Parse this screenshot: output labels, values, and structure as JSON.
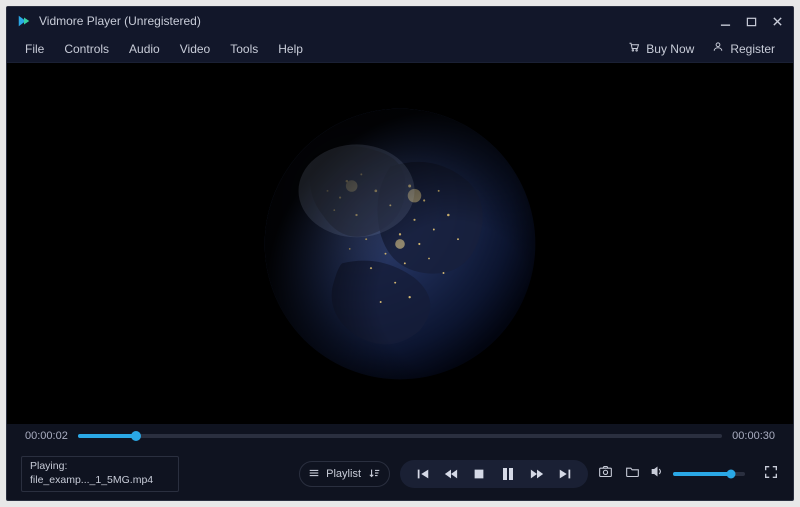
{
  "window": {
    "title": "Vidmore Player (Unregistered)"
  },
  "menubar": {
    "items": [
      "File",
      "Controls",
      "Audio",
      "Video",
      "Tools",
      "Help"
    ],
    "buyNow": "Buy Now",
    "register": "Register"
  },
  "progress": {
    "current": "00:00:02",
    "total": "00:00:30"
  },
  "nowPlaying": {
    "label": "Playing:",
    "filename": "file_examp..._1_5MG.mp4"
  },
  "playlist": {
    "label": "Playlist"
  }
}
